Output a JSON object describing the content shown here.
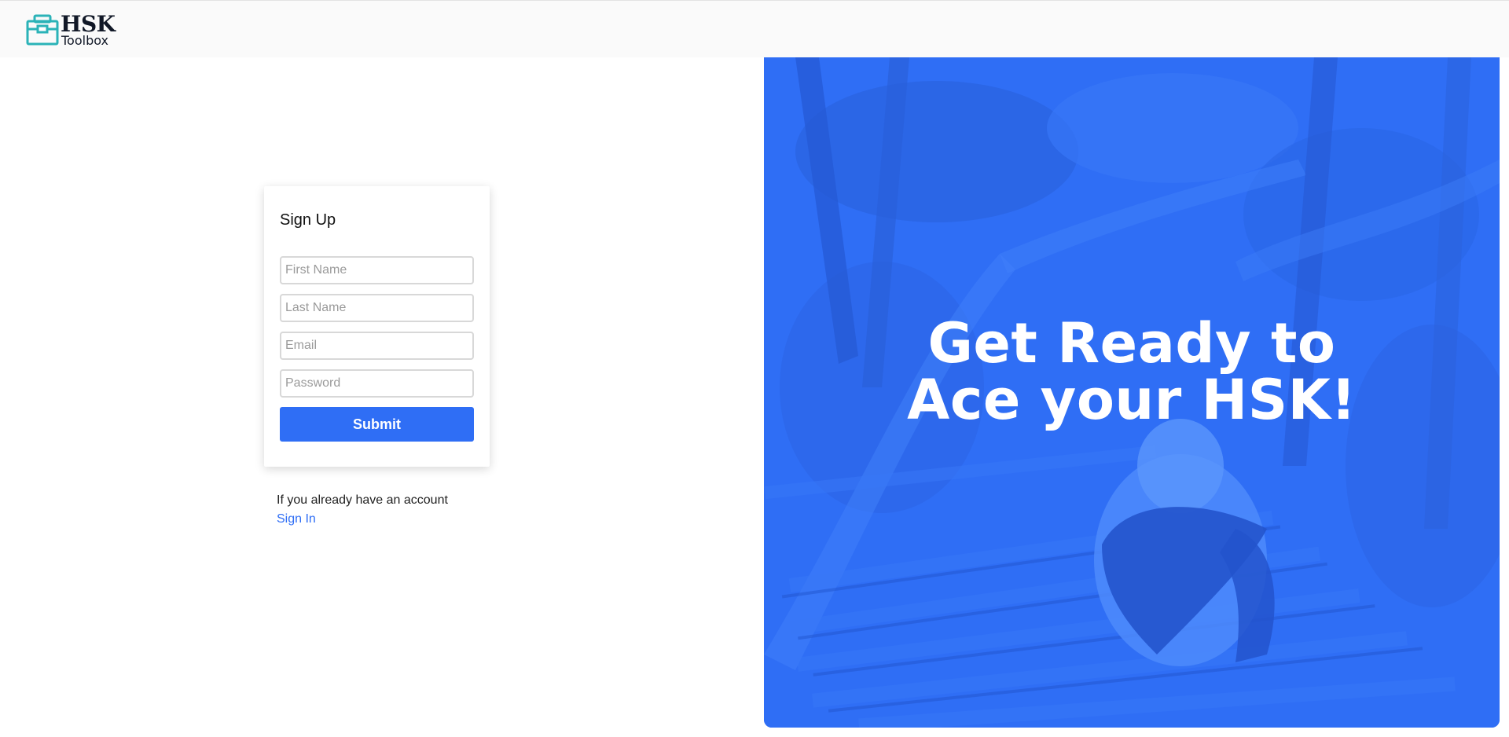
{
  "header": {
    "logo_title": "HSK",
    "logo_subtitle": "Toolbox"
  },
  "signup": {
    "title": "Sign Up",
    "first_name_placeholder": "First Name",
    "last_name_placeholder": "Last Name",
    "email_placeholder": "Email",
    "password_placeholder": "Password",
    "submit_label": "Submit"
  },
  "account": {
    "note": "If you already have an account",
    "signin_label": "Sign In"
  },
  "hero": {
    "line1": "Get Ready to",
    "line2": "Ace your HSK!"
  },
  "colors": {
    "accent": "#2f6ef5",
    "logo_teal": "#2bb3b8"
  },
  "icons": {
    "logo": "toolbox-icon"
  }
}
